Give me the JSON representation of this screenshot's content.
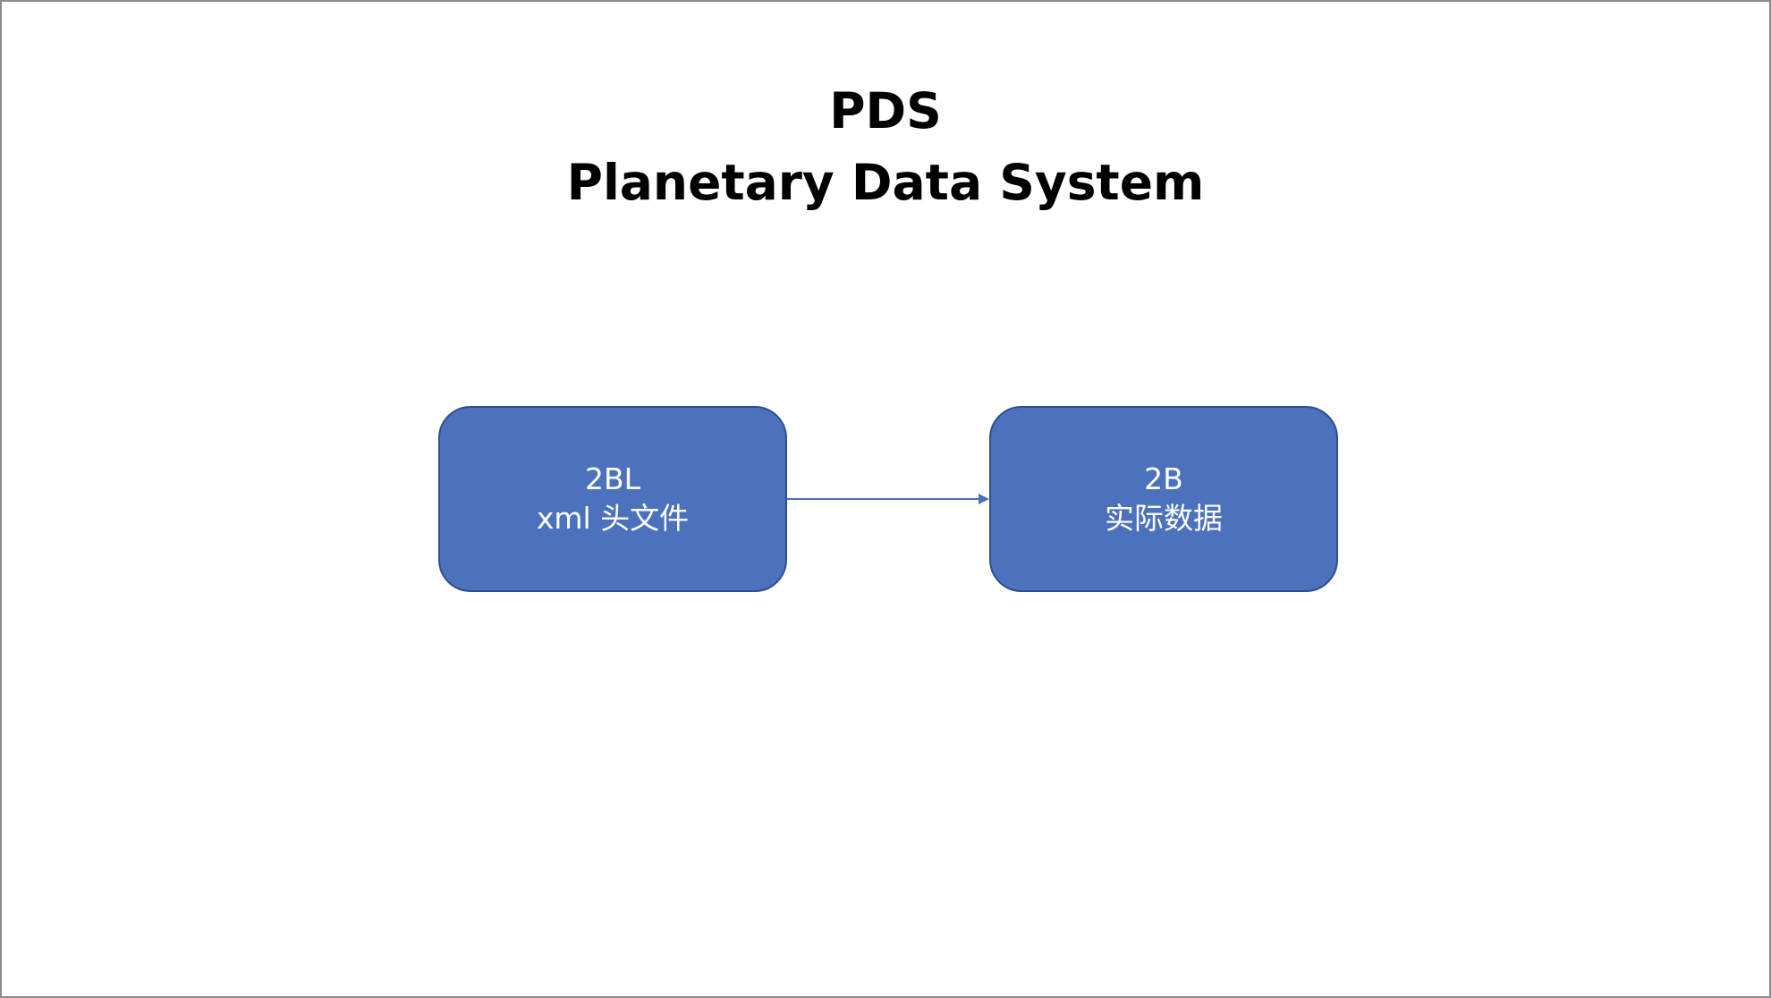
{
  "title": {
    "line1": "PDS",
    "line2": "Planetary Data System"
  },
  "nodes": [
    {
      "line1": "2BL",
      "line2": "xml 头文件"
    },
    {
      "line1": "2B",
      "line2": "实际数据"
    }
  ],
  "colors": {
    "node_fill": "#4c72bd",
    "node_border": "#2f4f8f",
    "arrow": "#4a6fb8"
  }
}
